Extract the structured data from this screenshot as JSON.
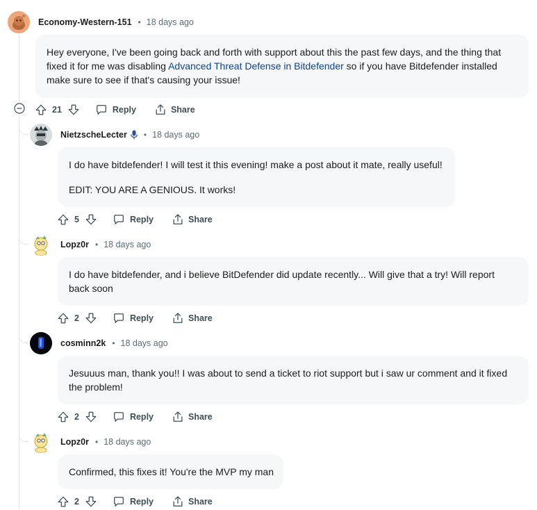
{
  "comments": [
    {
      "author": "Economy-Western-151",
      "time": "18 days ago",
      "body_parts": [
        "Hey everyone, I've been going back and forth with support about this the past few days, and the thing that fixed it for me was disabling ",
        "Advanced Threat Defense in Bitdefender",
        " so if you have Bitdefender installed make sure to see if that's causing your issue!"
      ],
      "votes": "21",
      "reply_label": "Reply",
      "share_label": "Share"
    },
    {
      "author": "NietzscheLecter",
      "time": "18 days ago",
      "body_lines": [
        "I do have bitdefender! I will test it this evening! make a post about it mate, really useful!",
        "EDIT: YOU ARE A GENIOUS. It works!"
      ],
      "votes": "5",
      "reply_label": "Reply",
      "share_label": "Share"
    },
    {
      "author": "Lopz0r",
      "time": "18 days ago",
      "body_lines": [
        "I do have bitdefender, and i believe BitDefender did update recently... Will give that a try! Will report",
        "back soon"
      ],
      "votes": "2",
      "reply_label": "Reply",
      "share_label": "Share"
    },
    {
      "author": "cosminn2k",
      "time": "18 days ago",
      "body_lines": [
        "Jesuuus man, thank you!! I was about to send a ticket to riot support but i saw ur comment and it fixed",
        "the problem!"
      ],
      "votes": "2",
      "reply_label": "Reply",
      "share_label": "Share"
    },
    {
      "author": "Lopz0r",
      "time": "18 days ago",
      "body_lines": [
        "Confirmed, this fixes it! You're the MVP my man"
      ],
      "votes": "2",
      "reply_label": "Reply",
      "share_label": "Share"
    }
  ],
  "separator": "•",
  "icons": [
    "avatar",
    "upvote-icon",
    "downvote-icon",
    "reply-icon",
    "share-icon",
    "collapse-icon",
    "mic-icon"
  ],
  "colors": {
    "link": "#0a449b",
    "bubble_bg": "#f6f7f8",
    "meta_text": "#576f76",
    "flair_mic": "#2a4fa1"
  }
}
